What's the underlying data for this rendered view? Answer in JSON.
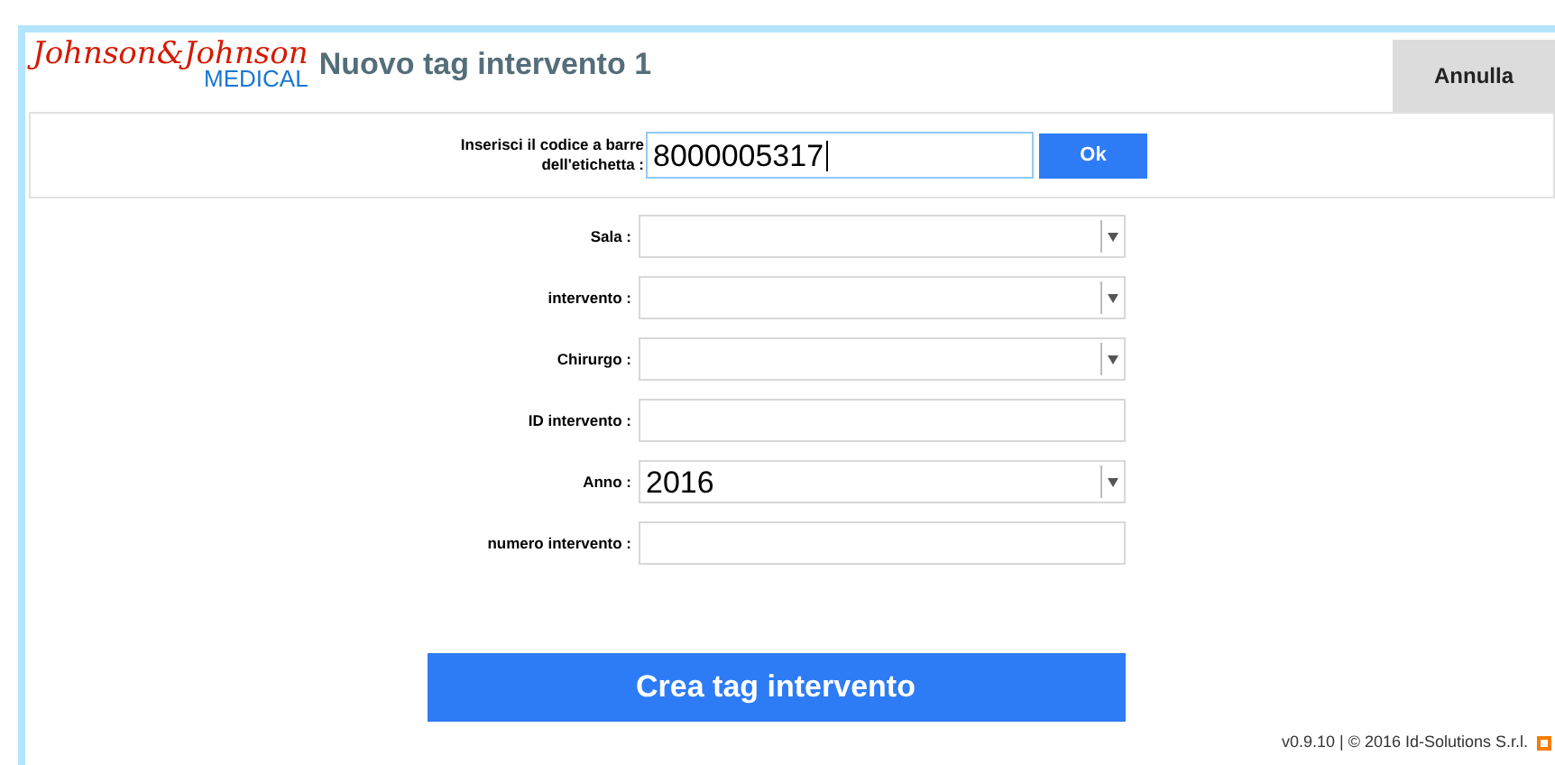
{
  "header": {
    "logo": {
      "brand": "Johnson&Johnson",
      "division": "MEDICAL"
    },
    "title": "Nuovo tag intervento 1",
    "cancel_button": "Annulla"
  },
  "barcode": {
    "label": "Inserisci il codice a barre dell'etichetta :",
    "value": "8000005317",
    "ok_button": "Ok"
  },
  "fields": [
    {
      "kind": "select",
      "label": "Sala :"
    },
    {
      "kind": "select",
      "label": "intervento :"
    },
    {
      "kind": "select",
      "label": "Chirurgo :"
    },
    {
      "kind": "text",
      "label": "ID intervento :"
    },
    {
      "kind": "select",
      "label": "Anno :",
      "value": "2016"
    },
    {
      "kind": "text",
      "label": "numero intervento :"
    }
  ],
  "submit_button": "Crea tag intervento",
  "footer": "v0.9.10 | © 2016 Id-Solutions S.r.l."
}
